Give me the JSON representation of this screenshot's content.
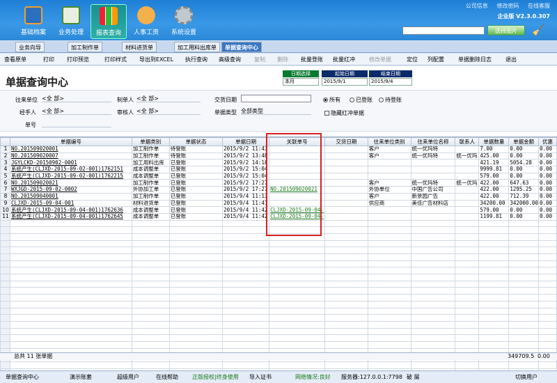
{
  "nav": [
    "基础档案",
    "业务处理",
    "报表查询",
    "人事工资",
    "系统设置"
  ],
  "top_links": [
    "公司信息",
    "修改密码",
    "在线客服"
  ],
  "version": "企业版 V2.3.0.307",
  "select_pic": "选择图片",
  "tabs": [
    "业务向导",
    "加工制作单",
    "材料进货单",
    "加工用料出库单",
    "单据查询中心"
  ],
  "toolbar": [
    "查看原单",
    "打印",
    "打印预览",
    "打印样式",
    "导出到EXCEL",
    "执行查询",
    "高级查询",
    "复制",
    "删除",
    "批量登账",
    "批量红冲",
    "修改单据",
    "定位",
    "列配置",
    "单据删除日志",
    "退出"
  ],
  "page_title": "单据查询中心",
  "date": {
    "select_label": "日期选择",
    "start_label": "起始日期",
    "end_label": "结束日期",
    "select_val": "本月",
    "start_val": "2015/9/1",
    "end_val": "2015/9/4"
  },
  "filter": {
    "l_unit": "往来单位",
    "v_unit": "<全 部>",
    "l_maker": "制单人",
    "v_maker": "<全 部>",
    "l_trade": "交货日期",
    "l_handler": "经手人",
    "v_handler": "<全 部>",
    "l_auditor": "审核人",
    "v_auditor": "<全 部>",
    "l_type": "单据类型",
    "v_type": "全部类型",
    "l_no": "单号",
    "r_all": "所有",
    "r_posted": "已登账",
    "r_pending": "待登账",
    "hide_red": "隐藏红冲单据"
  },
  "columns": [
    "",
    "单据编号",
    "单据类别",
    "单据状态",
    "单据日期",
    "关联单号",
    "交货日期",
    "往来单位类别",
    "往来单位名称",
    "联系人",
    "单据数量",
    "单据金额",
    "优惠"
  ],
  "rows": [
    [
      "1",
      "NO.201509020001",
      "加工制作单",
      "待登账",
      "2015/9/2 11:43",
      "",
      "",
      "客户",
      "统一优玛特",
      "",
      "7.00",
      "0.00",
      "0.00"
    ],
    [
      "2",
      "NO.201509020007",
      "加工制作单",
      "待登账",
      "2015/9/2 13:48",
      "",
      "",
      "客户",
      "统一优玛特",
      "统一优玛",
      "425.00",
      "0.00",
      "0.00"
    ],
    [
      "3",
      "JGYLCKD-20150902-0001",
      "加工用料出库",
      "已登账",
      "2015/9/2 14:18",
      "",
      "",
      "",
      "",
      "",
      "421.19",
      "5054.28",
      "0.00"
    ],
    [
      "4",
      "系统产生(CLJXD-2015-09-02-001)1762151",
      "成本调整单",
      "已登账",
      "2015/9/2 15:04",
      "",
      "",
      "",
      "",
      "",
      "9999.81",
      "0.00",
      "0.00"
    ],
    [
      "5",
      "系统产生(CLJXD-2015-09-02-001)1762215",
      "成本调整单",
      "已登账",
      "2015/9/2 15:04",
      "",
      "",
      "",
      "",
      "",
      "579.00",
      "0.00",
      "0.00"
    ],
    [
      "6",
      "NO.201509020021",
      "加工制作单",
      "已登账",
      "2015/9/2 17:27",
      "",
      "",
      "客户",
      "统一优玛特",
      "统一优玛",
      "422.00",
      "647.63",
      "0.00"
    ],
    [
      "7",
      "WXJGD-2015-09-02-0002",
      "外协加工单",
      "已登账",
      "2015/9/2 17:27",
      "NO.201509020021",
      "",
      "外协单位",
      "中国广告公司",
      "",
      "422.00",
      "1295.25",
      "0.00"
    ],
    [
      "8",
      "NO.201509040001",
      "加工制作单",
      "已登账",
      "2015/9/4 11:13",
      "",
      "",
      "客户",
      "新景园广告",
      "",
      "422.00",
      "712.39",
      "0.00"
    ],
    [
      "9",
      "CLJXD-2015-09-04-001",
      "材料进货单",
      "已登账",
      "2015/9/4 11:41",
      "",
      "",
      "供应商",
      "美佳广告材料店",
      "",
      "34200.00",
      "342000.00",
      "0.00"
    ],
    [
      "10",
      "系统产生(CLJXD-2015-09-04-001)1762636",
      "成本调整单",
      "已登账",
      "2015/9/4 11:42",
      "CLJXD-2015-09-04-",
      "",
      "",
      "",
      "",
      "579.00",
      "0.00",
      "0.00"
    ],
    [
      "11",
      "系统产生(CLJXD-2015-09-04-001)1762645",
      "成本调整单",
      "已登账",
      "2015/9/4 11:42",
      "CLJXD-2015-09-04-",
      "",
      "",
      "",
      "",
      "1199.81",
      "0.00",
      "0.00"
    ]
  ],
  "footer": {
    "count": "总共 11 张单据",
    "sum_qty": "349709.5",
    "sum_amt": "0.00"
  },
  "status": [
    "单据查询中心",
    "演示账套",
    "超级用户",
    "在线帮助",
    "正版授权|终身使用",
    "导入证书",
    "网络情况:良好",
    "服务器:127.0.0.1:7798",
    "破 屑",
    "切换用户"
  ]
}
